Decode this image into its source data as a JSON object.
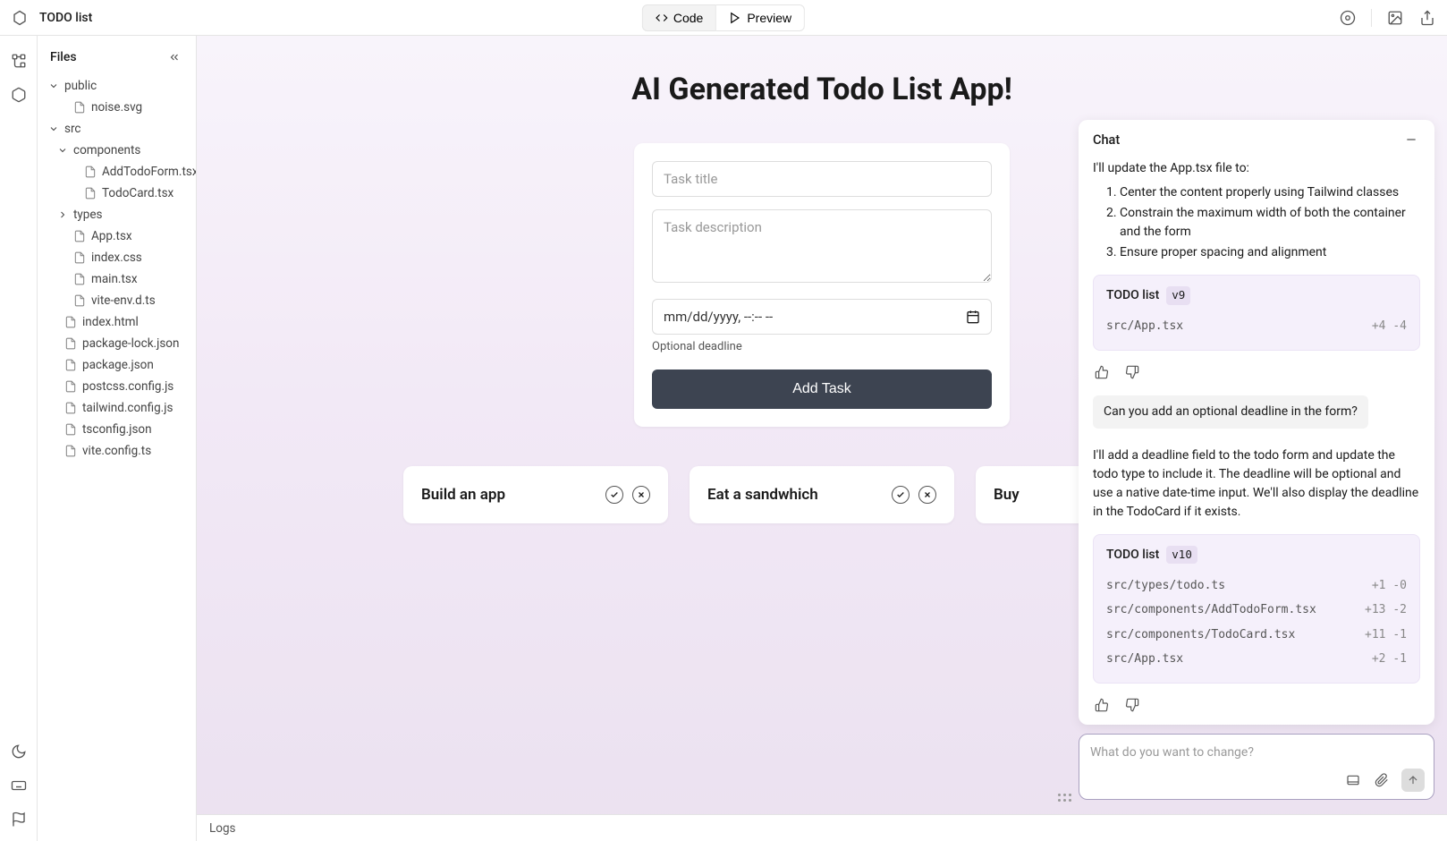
{
  "header": {
    "project_title": "TODO list",
    "tabs": {
      "code": "Code",
      "preview": "Preview"
    }
  },
  "sidebar": {
    "title": "Files",
    "tree": [
      {
        "type": "folder",
        "name": "public",
        "open": true,
        "depth": 0
      },
      {
        "type": "file",
        "name": "noise.svg",
        "depth": 1
      },
      {
        "type": "folder",
        "name": "src",
        "open": true,
        "depth": 0
      },
      {
        "type": "folder",
        "name": "components",
        "open": true,
        "depth": 1
      },
      {
        "type": "file",
        "name": "AddTodoForm.tsx",
        "depth": 2
      },
      {
        "type": "file",
        "name": "TodoCard.tsx",
        "depth": 2
      },
      {
        "type": "folder",
        "name": "types",
        "open": false,
        "depth": 1
      },
      {
        "type": "file",
        "name": "App.tsx",
        "depth": 1
      },
      {
        "type": "file",
        "name": "index.css",
        "depth": 1
      },
      {
        "type": "file",
        "name": "main.tsx",
        "depth": 1
      },
      {
        "type": "file",
        "name": "vite-env.d.ts",
        "depth": 1
      },
      {
        "type": "file",
        "name": "index.html",
        "depth": 0
      },
      {
        "type": "file",
        "name": "package-lock.json",
        "depth": 0
      },
      {
        "type": "file",
        "name": "package.json",
        "depth": 0
      },
      {
        "type": "file",
        "name": "postcss.config.js",
        "depth": 0
      },
      {
        "type": "file",
        "name": "tailwind.config.js",
        "depth": 0
      },
      {
        "type": "file",
        "name": "tsconfig.json",
        "depth": 0
      },
      {
        "type": "file",
        "name": "vite.config.ts",
        "depth": 0
      }
    ]
  },
  "preview": {
    "app_title": "AI Generated Todo List App!",
    "form": {
      "title_placeholder": "Task title",
      "description_placeholder": "Task description",
      "date_placeholder": "mm/dd/yyyy, --:-- --",
      "optional_label": "Optional deadline",
      "add_button": "Add Task"
    },
    "todos": [
      {
        "title": "Build an app"
      },
      {
        "title": "Eat a sandwhich"
      },
      {
        "title": "Buy"
      }
    ]
  },
  "chat": {
    "title": "Chat",
    "msg1_intro": "I'll update the App.tsx file to:",
    "msg1_items": [
      "Center the content properly using Tailwind classes",
      "Constrain the maximum width of both the container and the form",
      "Ensure proper spacing and alignment"
    ],
    "card1": {
      "title": "TODO list",
      "version": "v9",
      "files": [
        {
          "path": "src/App.tsx",
          "diff": "+4 -4"
        }
      ]
    },
    "user_msg": "Can you add an optional deadline in the form?",
    "msg2": "I'll add a deadline field to the todo form and update the todo type to include it. The deadline will be optional and use a native date-time input. We'll also display the deadline in the TodoCard if it exists.",
    "card2": {
      "title": "TODO list",
      "version": "v10",
      "files": [
        {
          "path": "src/types/todo.ts",
          "diff": "+1 -0"
        },
        {
          "path": "src/components/AddTodoForm.tsx",
          "diff": "+13 -2"
        },
        {
          "path": "src/components/TodoCard.tsx",
          "diff": "+11 -1"
        },
        {
          "path": "src/App.tsx",
          "diff": "+2 -1"
        }
      ]
    },
    "input_placeholder": "What do you want to change?"
  },
  "footer": {
    "logs": "Logs"
  }
}
